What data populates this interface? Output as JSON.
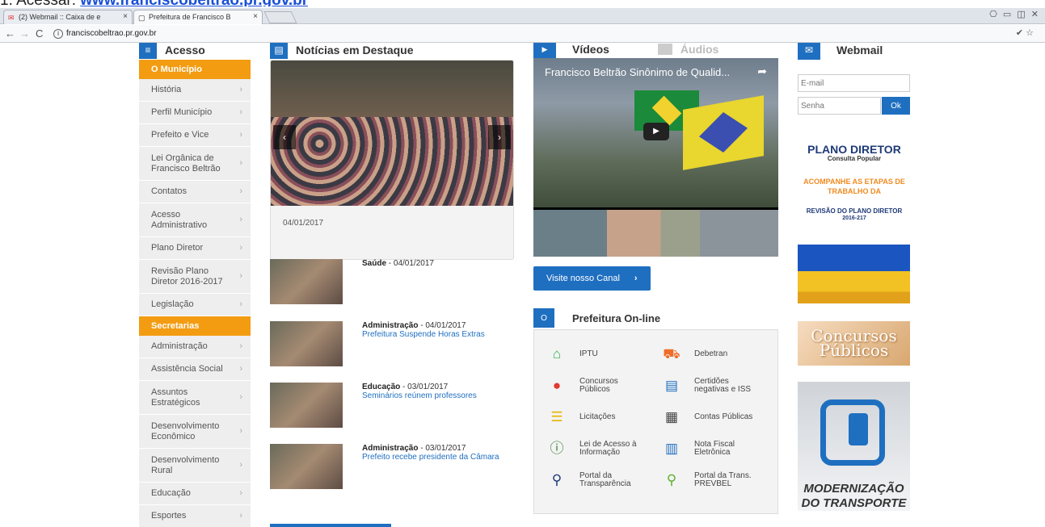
{
  "annotation": {
    "prefix": "1. Acessar: ",
    "link": "www.franciscobeltrao.pr.gov.br"
  },
  "browser": {
    "tabs": [
      {
        "label": "(2) Webmail :: Caixa de e"
      },
      {
        "label": "Prefeitura de Francisco B"
      }
    ],
    "url": "franciscobeltrao.pr.gov.br"
  },
  "acesso": {
    "title": "Acesso",
    "section1": "O Município",
    "items1": [
      "História",
      "Perfil Município",
      "Prefeito e Vice",
      "Lei Orgânica de Francisco Beltrão",
      "Contatos",
      "Acesso Administrativo",
      "Plano Diretor",
      "Revisão Plano Diretor 2016-2017",
      "Legislação"
    ],
    "section2": "Secretarias",
    "items2": [
      "Administração",
      "Assistência Social",
      "Assuntos Estratégicos",
      "Desenvolvimento Econômico",
      "Desenvolvimento Rural",
      "Educação",
      "Esportes"
    ]
  },
  "news": {
    "title": "Notícias em Destaque",
    "featured_date": "04/01/2017",
    "items": [
      {
        "cat": "Saúde",
        "date": " - 04/01/2017",
        "title": ""
      },
      {
        "cat": "Administração",
        "date": " - 04/01/2017",
        "title": "Prefeitura Suspende Horas Extras"
      },
      {
        "cat": "Educação",
        "date": " - 03/01/2017",
        "title": "Seminários reúnem professores"
      },
      {
        "cat": "Administração",
        "date": " - 03/01/2017",
        "title": "Prefeito recebe presidente da Câmara"
      }
    ]
  },
  "videos": {
    "title": "Vídeos",
    "audio_title": "Áudios",
    "player_title": "Francisco Beltrão Sinônimo de Qualid...",
    "canal": "Visite nosso Canal"
  },
  "online": {
    "title": "Prefeitura On-line",
    "services": [
      "IPTU",
      "Debetran",
      "Concursos Públicos",
      "Certidões negativas e ISS",
      "Licitações",
      "Contas Públicas",
      "Lei de Acesso à Informação",
      "Nota Fiscal Eletrônica",
      "Portal da Transparência",
      "Portal da Trans. PREVBEL"
    ]
  },
  "webmail": {
    "title": "Webmail",
    "email_placeholder": "E-mail",
    "senha_placeholder": "Senha",
    "ok": "Ok"
  },
  "banners": {
    "pd_a": "PLANO DIRETOR",
    "pd_b": "Consulta Popular",
    "pd_c": "ACOMPANHE AS ETAPAS DE TRABALHO DA",
    "pd_d": "REVISÃO DO PLANO DIRETOR",
    "pd_e": "2016-217",
    "concursos": "Concursos Públicos",
    "transporte": "MODERNIZAÇÃO DO TRANSPORTE"
  }
}
